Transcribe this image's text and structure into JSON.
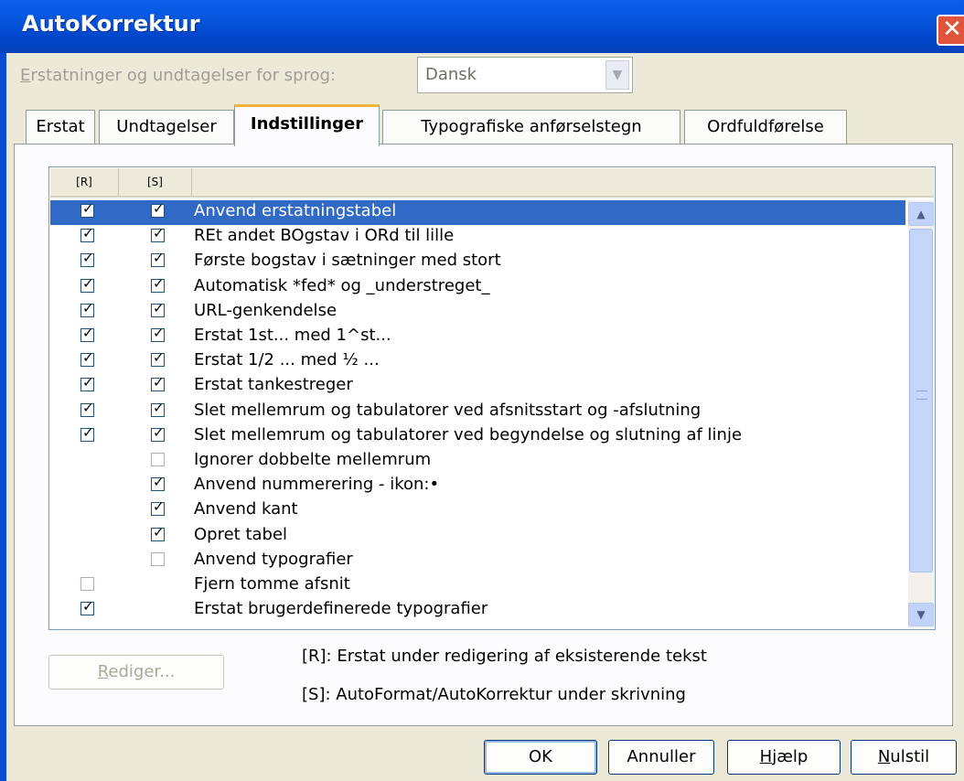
{
  "dialog": {
    "title": "AutoKorrektur"
  },
  "language": {
    "label_prefix": "E",
    "label_rest": "rstatninger og undtagelser for sprog:",
    "selected": "Dansk"
  },
  "tabs": [
    {
      "label": "Erstat",
      "active": false
    },
    {
      "label": "Undtagelser",
      "active": false
    },
    {
      "label": "Indstillinger",
      "active": true
    },
    {
      "label": "Typografiske anførselstegn",
      "active": false
    },
    {
      "label": "Ordfuldførelse",
      "active": false
    }
  ],
  "options_list": {
    "columns": [
      "[R]",
      "[S]"
    ],
    "rows": [
      {
        "label": "Anvend erstatningstabel",
        "r": true,
        "s": true,
        "selected": true
      },
      {
        "label": "REt andet BOgstav i ORd til lille",
        "r": true,
        "s": true
      },
      {
        "label": "Første bogstav i sætninger med stort",
        "r": true,
        "s": true
      },
      {
        "label": "Automatisk *fed* og _understreget_",
        "r": true,
        "s": true
      },
      {
        "label": "URL-genkendelse",
        "r": true,
        "s": true
      },
      {
        "label": "Erstat 1st... med 1^st...",
        "r": true,
        "s": true
      },
      {
        "label": "Erstat 1/2 ... med ½ ...",
        "r": true,
        "s": true
      },
      {
        "label": "Erstat tankestreger",
        "r": true,
        "s": true
      },
      {
        "label": "Slet mellemrum og tabulatorer ved afsnitsstart og -afslutning",
        "r": true,
        "s": true
      },
      {
        "label": "Slet mellemrum og tabulatorer ved begyndelse og slutning af linje",
        "r": true,
        "s": true
      },
      {
        "label": "Ignorer dobbelte mellemrum",
        "r": null,
        "s": false
      },
      {
        "label": "Anvend nummerering - ikon:•",
        "r": null,
        "s": true
      },
      {
        "label": "Anvend kant",
        "r": null,
        "s": true
      },
      {
        "label": "Opret tabel",
        "r": null,
        "s": true
      },
      {
        "label": "Anvend typografier",
        "r": null,
        "s": false
      },
      {
        "label": "Fjern tomme afsnit",
        "r": false,
        "s": null
      },
      {
        "label": "Erstat brugerdefinerede typografier",
        "r": true,
        "s": null
      }
    ]
  },
  "edit_button": {
    "mnemonic": "R",
    "rest": "ediger..."
  },
  "legend": {
    "r": "[R]: Erstat under redigering af eksisterende tekst",
    "s": "[S]: AutoFormat/AutoKorrektur under skrivning"
  },
  "buttons": {
    "ok": "OK",
    "cancel": "Annuller",
    "help_mnemonic": "H",
    "help_rest": "jælp",
    "reset_mnemonic": "N",
    "reset_rest": "ulstil"
  },
  "icons": {
    "close": "close-icon",
    "dropdown": "chevron-down-icon",
    "scroll_up": "chevron-up-icon",
    "scroll_down": "chevron-down-icon",
    "check": "checkmark-icon"
  },
  "colors": {
    "titlebar": "#0054e3",
    "selection": "#3169c6",
    "active_tab": "#f6b33a"
  }
}
